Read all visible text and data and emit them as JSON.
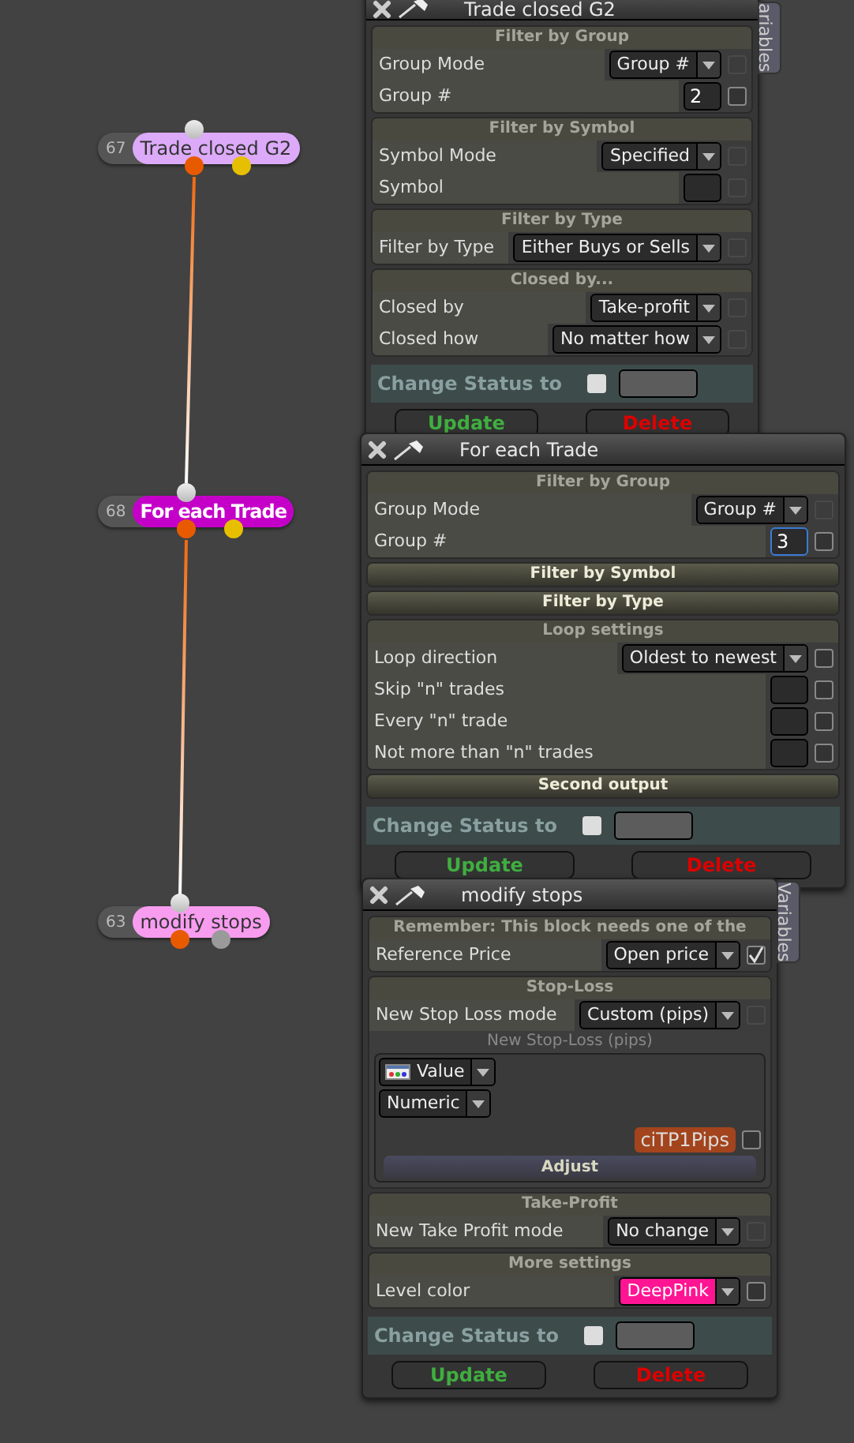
{
  "nodes": [
    {
      "number": "67",
      "label": "Trade closed G2",
      "color": "#dcaaf8",
      "selected": false
    },
    {
      "number": "68",
      "label": "For each Trade",
      "color": "#c400c8",
      "selected": true
    },
    {
      "number": "63",
      "label": "modify stops",
      "color": "#f89cf0",
      "selected": false
    }
  ],
  "panels": [
    {
      "title": "Trade closed G2",
      "variables_tab": "ariables",
      "sections": [
        {
          "title": "Filter by Group",
          "expanded": true,
          "rows": [
            {
              "kind": "select",
              "label": "Group Mode",
              "value": "Group #",
              "checked": false,
              "disabled": true
            },
            {
              "kind": "input",
              "label": "Group #",
              "value": "2",
              "focused": false,
              "checked": false,
              "disabled": false
            }
          ]
        },
        {
          "title": "Filter by Symbol",
          "expanded": true,
          "rows": [
            {
              "kind": "select",
              "label": "Symbol Mode",
              "value": "Specified",
              "checked": false,
              "disabled": true
            },
            {
              "kind": "input",
              "label": "Symbol",
              "focused": false,
              "checked": false,
              "disabled": true
            }
          ]
        },
        {
          "title": "Filter by Type",
          "expanded": true,
          "rows": [
            {
              "kind": "select",
              "label": "Filter by Type",
              "value": "Either Buys or Sells",
              "checked": false,
              "disabled": true
            }
          ]
        },
        {
          "title": "Closed by...",
          "expanded": true,
          "rows": [
            {
              "kind": "select",
              "label": "Closed by",
              "value": "Take-profit",
              "checked": false,
              "disabled": true
            },
            {
              "kind": "select",
              "label": "Closed how",
              "value": "No matter how",
              "checked": false,
              "disabled": true
            }
          ]
        }
      ],
      "status": {
        "label": "Change Status to",
        "checked": false
      },
      "buttons": [
        {
          "kind": "update",
          "label": "Update"
        },
        {
          "kind": "delete",
          "label": "Delete"
        }
      ]
    },
    {
      "title": "For each Trade",
      "sections": [
        {
          "title": "Filter by Group",
          "expanded": true,
          "rows": [
            {
              "kind": "select",
              "label": "Group Mode",
              "value": "Group #",
              "checked": false,
              "disabled": true
            },
            {
              "kind": "input",
              "label": "Group #",
              "value": "3",
              "focused": true,
              "checked": false,
              "disabled": false
            }
          ]
        },
        {
          "title": "Filter by Symbol",
          "expanded": false
        },
        {
          "title": "Filter by Type",
          "expanded": false
        },
        {
          "title": "Loop settings",
          "expanded": true,
          "rows": [
            {
              "kind": "select",
              "label": "Loop direction",
              "value": "Oldest to newest",
              "checked": false,
              "disabled": false
            },
            {
              "kind": "input",
              "label": "Skip \"n\" trades",
              "focused": false,
              "checked": false,
              "disabled": false
            },
            {
              "kind": "input",
              "label": "Every \"n\" trade",
              "focused": false,
              "checked": false,
              "disabled": false
            },
            {
              "kind": "input",
              "label": "Not more than \"n\" trades",
              "focused": false,
              "checked": false,
              "disabled": false
            }
          ]
        },
        {
          "title": "Second output",
          "expanded": false
        }
      ],
      "status": {
        "label": "Change Status to",
        "checked": false
      },
      "buttons": [
        {
          "kind": "update",
          "label": "Update"
        },
        {
          "kind": "delete",
          "label": "Delete"
        }
      ]
    },
    {
      "title": "modify stops",
      "variables_tab": "Variables",
      "sections": [
        {
          "title": "Remember: This block needs one of the",
          "expanded": true,
          "rows": [
            {
              "kind": "select",
              "label": "Reference Price",
              "value": "Open price",
              "checked": true,
              "disabled": false
            }
          ]
        },
        {
          "title": "Stop-Loss",
          "expanded": true,
          "rows": [
            {
              "kind": "select",
              "label": "New Stop Loss mode",
              "value": "Custom (pips)",
              "checked": false,
              "disabled": true
            },
            {
              "kind": "subgroup",
              "title": "New Stop-Loss (pips)",
              "source": "Value",
              "type": "Numeric",
              "variable": "ciTP1Pips",
              "checked": false,
              "button": "Adjust"
            }
          ]
        },
        {
          "title": "Take-Profit",
          "expanded": true,
          "rows": [
            {
              "kind": "select",
              "label": "New Take Profit mode",
              "value": "No change",
              "checked": false,
              "disabled": true
            }
          ]
        },
        {
          "title": "More settings",
          "expanded": true,
          "rows": [
            {
              "kind": "select",
              "label": "Level color",
              "value": "DeepPink",
              "color": "#ff1493",
              "checked": false,
              "disabled": false
            }
          ]
        }
      ],
      "status": {
        "label": "Change Status to",
        "checked": false
      },
      "buttons": [
        {
          "kind": "update",
          "label": "Update"
        },
        {
          "kind": "delete",
          "label": "Delete"
        }
      ]
    }
  ]
}
